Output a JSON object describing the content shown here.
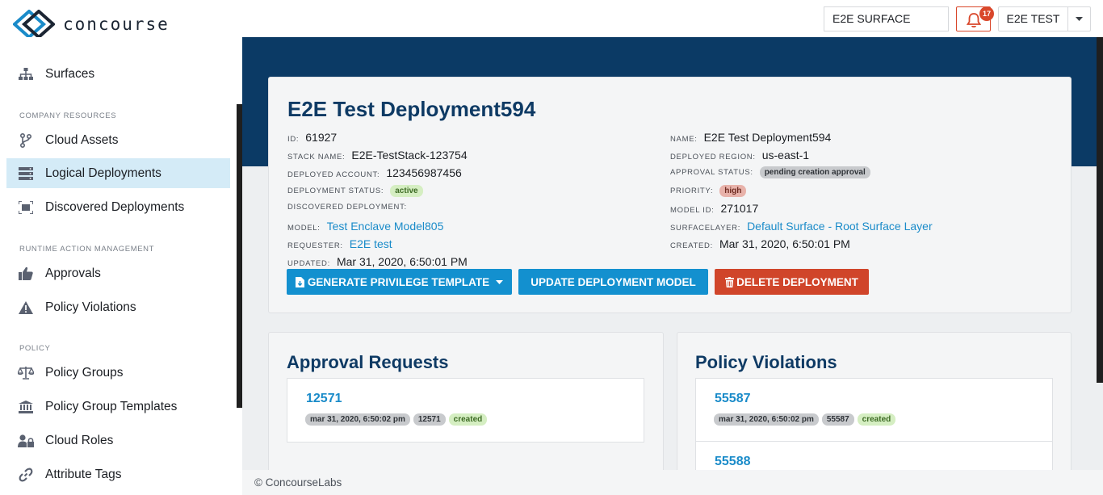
{
  "app": {
    "logo_text": "concourse"
  },
  "topbar": {
    "surface": "E2E SURFACE",
    "notifications_count": "17",
    "user": "E2E TEST"
  },
  "sidebar": {
    "items": [
      {
        "label": "Surfaces",
        "icon": "sitemap-icon"
      },
      {
        "label": "Cloud Assets",
        "icon": "code-branch-icon"
      },
      {
        "label": "Logical Deployments",
        "icon": "server-icon",
        "active": true
      },
      {
        "label": "Discovered Deployments",
        "icon": "scan-icon"
      },
      {
        "label": "Approvals",
        "icon": "thumbs-up-icon"
      },
      {
        "label": "Policy Violations",
        "icon": "warning-icon"
      },
      {
        "label": "Policy Groups",
        "icon": "scale-icon"
      },
      {
        "label": "Policy Group Templates",
        "icon": "bank-icon"
      },
      {
        "label": "Cloud Roles",
        "icon": "user-lock-icon"
      },
      {
        "label": "Attribute Tags",
        "icon": "link-icon"
      }
    ],
    "sections": {
      "company": "COMPANY RESOURCES",
      "runtime": "RUNTIME ACTION MANAGEMENT",
      "policy": "POLICY"
    }
  },
  "deployment": {
    "title": "E2E Test Deployment594",
    "labels": {
      "id": "ID:",
      "stack_name": "STACK NAME:",
      "deployed_account": "DEPLOYED ACCOUNT:",
      "deployment_status": "DEPLOYMENT STATUS:",
      "discovered_deployment": "DISCOVERED DEPLOYMENT:",
      "model": "MODEL:",
      "requester": "REQUESTER:",
      "updated": "UPDATED:",
      "name": "NAME:",
      "deployed_region": "DEPLOYED REGION:",
      "approval_status": "APPROVAL STATUS:",
      "priority": "PRIORITY:",
      "model_id": "MODEL ID:",
      "surfacelayer": "SURFACELAYER:",
      "created": "CREATED:"
    },
    "id": "61927",
    "stack_name": "E2E-TestStack-123754",
    "deployed_account": "123456987456",
    "deployment_status": "active",
    "discovered_deployment": "",
    "model": "Test Enclave Model805",
    "requester": "E2E test",
    "updated": "Mar 31, 2020, 6:50:01 PM",
    "name": "E2E Test Deployment594",
    "deployed_region": "us-east-1",
    "approval_status": "pending creation approval",
    "priority": "high",
    "model_id": "271017",
    "surfacelayer": "Default Surface - Root Surface Layer",
    "created": "Mar 31, 2020, 6:50:01 PM"
  },
  "buttons": {
    "generate": "GENERATE PRIVILEGE TEMPLATE",
    "update": "UPDATE DEPLOYMENT MODEL",
    "delete": "DELETE DEPLOYMENT"
  },
  "approvals": {
    "title": "Approval Requests",
    "items": [
      {
        "id": "12571",
        "date": "mar 31, 2020, 6:50:02 pm",
        "ref": "12571",
        "status": "created"
      }
    ]
  },
  "violations": {
    "title": "Policy Violations",
    "items": [
      {
        "id": "55587",
        "date": "mar 31, 2020, 6:50:02 pm",
        "ref": "55587",
        "status": "created"
      },
      {
        "id": "55588"
      }
    ]
  },
  "footer": {
    "text": "© ConcourseLabs"
  },
  "colors": {
    "navy": "#0b3a65",
    "accent_blue": "#1390cf",
    "danger": "#d0452a",
    "active_bg": "#d4ebf7"
  }
}
